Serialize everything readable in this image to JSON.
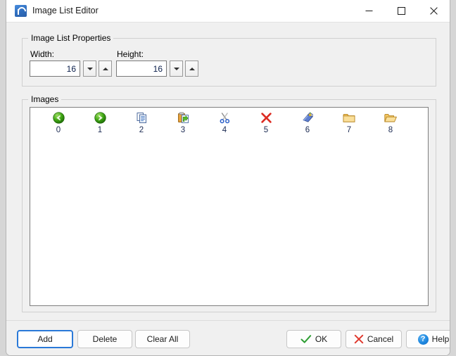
{
  "window": {
    "title": "Image List Editor",
    "icon": "app-icon",
    "controls": {
      "minimize": "minimize-icon",
      "maximize": "maximize-icon",
      "close": "close-icon"
    }
  },
  "properties": {
    "group_label": "Image List Properties",
    "width": {
      "label": "Width:",
      "value": "16",
      "decrement_icon": "chevron-down-icon",
      "increment_icon": "chevron-up-icon"
    },
    "height": {
      "label": "Height:",
      "value": "16",
      "decrement_icon": "chevron-down-icon",
      "increment_icon": "chevron-up-icon"
    }
  },
  "images": {
    "group_label": "Images",
    "items": [
      {
        "index": "0",
        "icon": "back-arrow-icon"
      },
      {
        "index": "1",
        "icon": "forward-arrow-icon"
      },
      {
        "index": "2",
        "icon": "copy-icon"
      },
      {
        "index": "3",
        "icon": "paste-icon"
      },
      {
        "index": "4",
        "icon": "cut-scissors-icon"
      },
      {
        "index": "5",
        "icon": "delete-x-icon"
      },
      {
        "index": "6",
        "icon": "book-tag-icon"
      },
      {
        "index": "7",
        "icon": "folder-closed-icon"
      },
      {
        "index": "8",
        "icon": "folder-open-icon"
      }
    ]
  },
  "buttons": {
    "add": "Add",
    "delete": "Delete",
    "clear_all": "Clear All",
    "ok": "OK",
    "cancel": "Cancel",
    "help": "Help",
    "help_glyph": "?"
  },
  "colors": {
    "accent": "#2a79d8",
    "ok_check": "#2e9e33",
    "cancel_x": "#e03a2f",
    "help_blue": "#1e88e0",
    "window_bg": "#f0f0f0",
    "titlebar_bg": "#ffffff",
    "list_bg": "#ffffff",
    "index_text": "#1b2a52"
  }
}
